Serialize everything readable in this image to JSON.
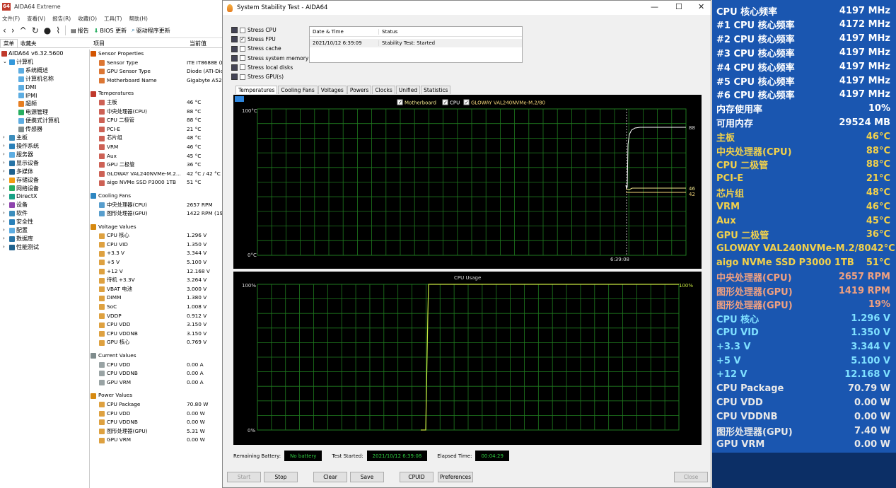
{
  "aida": {
    "title": "AIDA64 Extreme",
    "menu": [
      "文件(F)",
      "查看(V)",
      "报告(R)",
      "收藏(O)",
      "工具(T)",
      "帮助(H)"
    ],
    "toolbar": {
      "report": "报告",
      "bios": "BIOS 更新",
      "driver": "驱动程序更新"
    },
    "tabs": [
      "菜单",
      "收藏夹"
    ],
    "columns": {
      "item": "项目",
      "value": "当前值"
    },
    "tree": {
      "root": "AIDA64 v6.32.5600",
      "computer": "计算机",
      "computer_children": [
        "系统概述",
        "计算机名称",
        "DMI",
        "IPMI",
        "超频",
        "电源管理",
        "便携式计算机",
        "传感器"
      ],
      "others": [
        "主板",
        "操作系统",
        "服务器",
        "显示设备",
        "多媒体",
        "存储设备",
        "网络设备",
        "DirectX",
        "设备",
        "软件",
        "安全性",
        "配置",
        "数据库",
        "性能测试"
      ]
    },
    "groups": [
      {
        "title": "Sensor Properties",
        "icon": "sensor-icon",
        "rows": [
          {
            "name": "Sensor Type",
            "value": "ITE IT8688E  (IS"
          },
          {
            "name": "GPU Sensor Type",
            "value": "Diode  (ATI-Dio"
          },
          {
            "name": "Motherboard Name",
            "value": "Gigabyte A520"
          }
        ]
      },
      {
        "title": "Temperatures",
        "icon": "thermometer-icon",
        "rows": [
          {
            "name": "主板",
            "value": "46 °C"
          },
          {
            "name": "中央处理器(CPU)",
            "value": "88 °C"
          },
          {
            "name": "CPU 二极管",
            "value": "88 °C"
          },
          {
            "name": "PCI-E",
            "value": "21 °C"
          },
          {
            "name": "芯片组",
            "value": "48 °C"
          },
          {
            "name": "VRM",
            "value": "46 °C"
          },
          {
            "name": "Aux",
            "value": "45 °C"
          },
          {
            "name": "GPU 二极管",
            "value": "36 °C"
          },
          {
            "name": "GLOWAY VAL240NVMe-M.2...",
            "value": "42 °C / 42 °C"
          },
          {
            "name": "aigo NVMe SSD P3000 1TB",
            "value": "51 °C"
          }
        ]
      },
      {
        "title": "Cooling Fans",
        "icon": "fan-icon",
        "rows": [
          {
            "name": "中央处理器(CPU)",
            "value": "2657 RPM"
          },
          {
            "name": "图形处理器(GPU)",
            "value": "1422 RPM  (19"
          }
        ]
      },
      {
        "title": "Voltage Values",
        "icon": "voltage-icon",
        "rows": [
          {
            "name": "CPU 核心",
            "value": "1.296 V"
          },
          {
            "name": "CPU VID",
            "value": "1.350 V"
          },
          {
            "name": "+3.3 V",
            "value": "3.344 V"
          },
          {
            "name": "+5 V",
            "value": "5.100 V"
          },
          {
            "name": "+12 V",
            "value": "12.168 V"
          },
          {
            "name": "待机 +3.3V",
            "value": "3.264 V"
          },
          {
            "name": "VBAT 电池",
            "value": "3.000 V"
          },
          {
            "name": "DIMM",
            "value": "1.380 V"
          },
          {
            "name": "SoC",
            "value": "1.008 V"
          },
          {
            "name": "VDDP",
            "value": "0.912 V"
          },
          {
            "name": "CPU VDD",
            "value": "3.150 V"
          },
          {
            "name": "CPU VDDNB",
            "value": "3.150 V"
          },
          {
            "name": "GPU 核心",
            "value": "0.769 V"
          }
        ]
      },
      {
        "title": "Current Values",
        "icon": "current-icon",
        "rows": [
          {
            "name": "CPU VDD",
            "value": "0.00 A"
          },
          {
            "name": "CPU VDDNB",
            "value": "0.00 A"
          },
          {
            "name": "GPU VRM",
            "value": "0.00 A"
          }
        ]
      },
      {
        "title": "Power Values",
        "icon": "power-icon",
        "rows": [
          {
            "name": "CPU Package",
            "value": "70.80 W"
          },
          {
            "name": "CPU VDD",
            "value": "0.00 W"
          },
          {
            "name": "CPU VDDNB",
            "value": "0.00 W"
          },
          {
            "name": "图形处理器(GPU)",
            "value": "5.31 W"
          },
          {
            "name": "GPU VRM",
            "value": "0.00 W"
          }
        ]
      }
    ]
  },
  "stability": {
    "title": "System Stability Test - AIDA64",
    "stress": [
      {
        "label": "Stress CPU",
        "checked": false
      },
      {
        "label": "Stress FPU",
        "checked": true
      },
      {
        "label": "Stress cache",
        "checked": false
      },
      {
        "label": "Stress system memory",
        "checked": false
      },
      {
        "label": "Stress local disks",
        "checked": false
      },
      {
        "label": "Stress GPU(s)",
        "checked": false
      }
    ],
    "status_table": {
      "col_date": "Date & Time",
      "col_status": "Status",
      "date": "2021/10/12 6:39:09",
      "status": "Stability Test: Started"
    },
    "tabs": [
      "Temperatures",
      "Cooling Fans",
      "Voltages",
      "Powers",
      "Clocks",
      "Unified",
      "Statistics"
    ],
    "temp_chart": {
      "legend": [
        "Motherboard",
        "CPU",
        "GLOWAY VAL240NVMe-M.2/80"
      ],
      "y_top": "100°C",
      "y_bottom": "0°C",
      "time": "6:39:08",
      "end_labels": [
        "88",
        "46",
        "42"
      ],
      "colors": {
        "grid": "#1f7a1f",
        "motherboard": "#f0e68c",
        "cpu": "#ffffff",
        "gloway": "#f5d77a"
      }
    },
    "usage_chart": {
      "title": "CPU Usage",
      "y_top": "100%",
      "y_bottom": "0%",
      "end_label": "100%",
      "color": "#c8e640"
    },
    "bottom": {
      "battery_label": "Remaining Battery:",
      "battery": "No battery",
      "started_label": "Test Started:",
      "started": "2021/10/12 6:39:08",
      "elapsed_label": "Elapsed Time:",
      "elapsed": "00:04:29"
    },
    "buttons": {
      "start": "Start",
      "stop": "Stop",
      "clear": "Clear",
      "save": "Save",
      "cpuid": "CPUID",
      "prefs": "Preferences",
      "close": "Close"
    }
  },
  "osd": {
    "rows": [
      {
        "label": "CPU 核心频率",
        "value": "4197 MHz",
        "color": "#ffffff"
      },
      {
        "label": "#1 CPU 核心频率",
        "value": "4172 MHz",
        "color": "#ffffff"
      },
      {
        "label": "#2 CPU 核心频率",
        "value": "4197 MHz",
        "color": "#ffffff"
      },
      {
        "label": "#3 CPU 核心频率",
        "value": "4197 MHz",
        "color": "#ffffff"
      },
      {
        "label": "#4 CPU 核心频率",
        "value": "4197 MHz",
        "color": "#ffffff"
      },
      {
        "label": "#5 CPU 核心频率",
        "value": "4197 MHz",
        "color": "#ffffff"
      },
      {
        "label": "#6 CPU 核心频率",
        "value": "4197 MHz",
        "color": "#ffffff"
      },
      {
        "label": "内存使用率",
        "value": "10%",
        "color": "#ffffff"
      },
      {
        "label": "可用内存",
        "value": "29524 MB",
        "color": "#ffffff"
      },
      {
        "label": "主板",
        "value": "46°C",
        "color": "#f2d14b"
      },
      {
        "label": "中央处理器(CPU)",
        "value": "88°C",
        "color": "#f2d14b"
      },
      {
        "label": "CPU 二极管",
        "value": "88°C",
        "color": "#f2d14b"
      },
      {
        "label": "PCI-E",
        "value": "21°C",
        "color": "#f2d14b"
      },
      {
        "label": "芯片组",
        "value": "48°C",
        "color": "#f2d14b"
      },
      {
        "label": "VRM",
        "value": "46°C",
        "color": "#f2d14b"
      },
      {
        "label": "Aux",
        "value": "45°C",
        "color": "#f2d14b"
      },
      {
        "label": "GPU 二极管",
        "value": "36°C",
        "color": "#f2d14b"
      },
      {
        "label": "GLOWAY VAL240NVMe-M.2/80",
        "value": "42°C",
        "color": "#f2d14b"
      },
      {
        "label": "aigo NVMe SSD P3000 1TB",
        "value": "51°C",
        "color": "#f2d14b"
      },
      {
        "label": "中央处理器(CPU)",
        "value": "2657 RPM",
        "color": "#f0a080"
      },
      {
        "label": "图形处理器(GPU)",
        "value": "1419 RPM",
        "color": "#f0a080"
      },
      {
        "label": "图形处理器(GPU)",
        "value": "19%",
        "color": "#f0a080"
      },
      {
        "label": "CPU 核心",
        "value": "1.296 V",
        "color": "#7fe0ff"
      },
      {
        "label": "CPU VID",
        "value": "1.350 V",
        "color": "#7fe0ff"
      },
      {
        "label": "+3.3 V",
        "value": "3.344 V",
        "color": "#7fe0ff"
      },
      {
        "label": "+5 V",
        "value": "5.100 V",
        "color": "#7fe0ff"
      },
      {
        "label": "+12 V",
        "value": "12.168 V",
        "color": "#7fe0ff"
      },
      {
        "label": "CPU Package",
        "value": "70.79 W",
        "color": "#e8e8e8"
      },
      {
        "label": "CPU VDD",
        "value": "0.00 W",
        "color": "#e8e8e8"
      },
      {
        "label": "CPU VDDNB",
        "value": "0.00 W",
        "color": "#e8e8e8"
      },
      {
        "label": "图形处理器(GPU)",
        "value": "7.40 W",
        "color": "#e8e8e8"
      },
      {
        "label": "GPU VRM",
        "value": "0.00 W",
        "color": "#e8e8e8"
      }
    ]
  }
}
